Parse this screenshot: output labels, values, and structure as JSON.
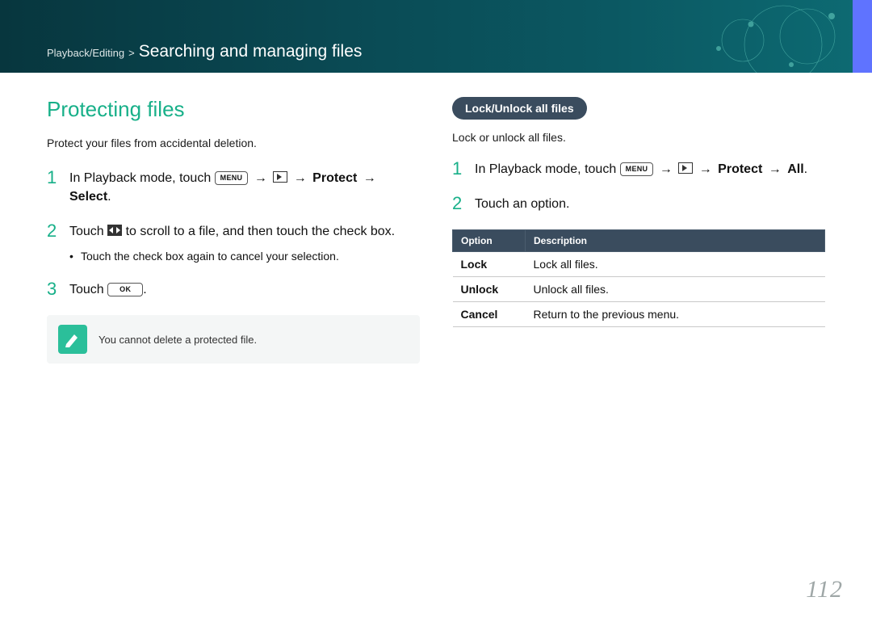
{
  "header": {
    "breadcrumb_parent": "Playback/Editing",
    "breadcrumb_child": "Searching and managing files"
  },
  "left": {
    "title": "Protecting files",
    "intro": "Protect your files from accidental deletion.",
    "step1_lead": "In Playback mode, touch ",
    "step1_menu": "MENU",
    "step1_protect": "Protect",
    "step1_tail": "Select",
    "step2_pre": "Touch ",
    "step2_post": " to scroll to a file, and then touch the check box.",
    "step2_bullet": "Touch the check box again to cancel your selection.",
    "step3_pre": "Touch ",
    "step3_ok": "OK",
    "note": "You cannot delete a protected file."
  },
  "right": {
    "pill": "Lock/Unlock all files",
    "intro": "Lock or unlock all files.",
    "step1_lead": "In Playback mode, touch ",
    "step1_menu": "MENU",
    "step1_protect": "Protect",
    "step1_tail": "All",
    "step2": "Touch an option.",
    "table": {
      "head_option": "Option",
      "head_desc": "Description",
      "rows": [
        {
          "opt": "Lock",
          "desc": "Lock all files."
        },
        {
          "opt": "Unlock",
          "desc": "Unlock all files."
        },
        {
          "opt": "Cancel",
          "desc": "Return to the previous menu."
        }
      ]
    }
  },
  "page_number": "112"
}
